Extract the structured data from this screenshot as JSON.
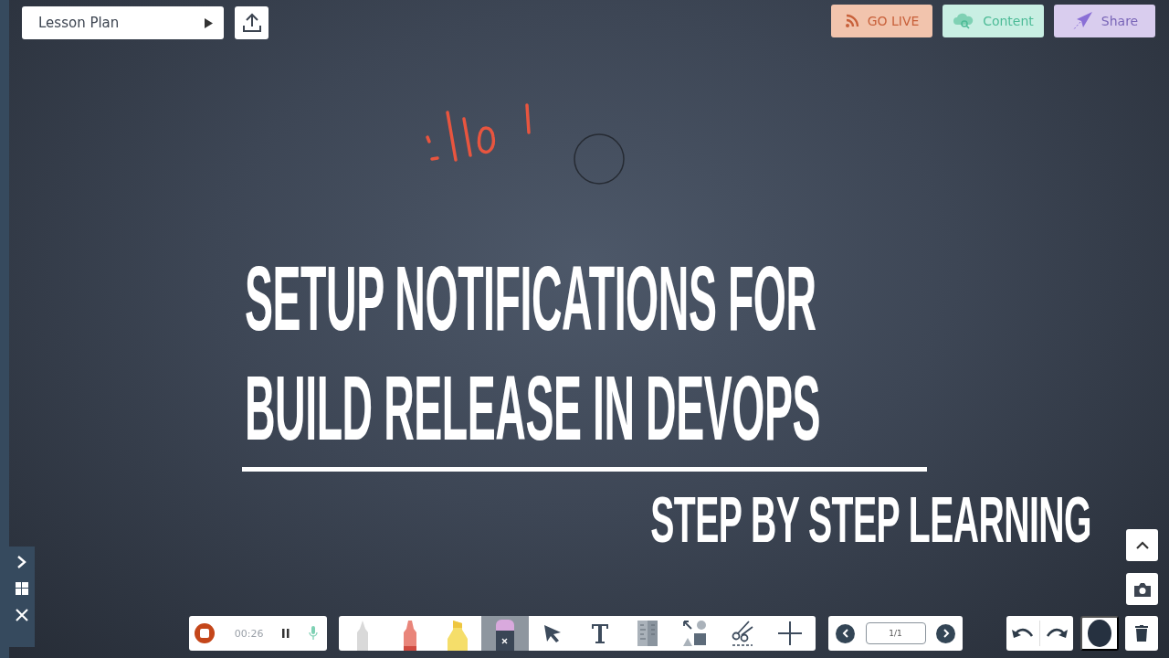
{
  "top_bar": {
    "lesson_plan": {
      "label": "Lesson Plan"
    },
    "buttons": [
      {
        "label": "GO LIVE",
        "kind": "live"
      },
      {
        "label": "Content",
        "kind": "content"
      },
      {
        "label": "Share",
        "kind": "share"
      }
    ]
  },
  "canvas": {
    "title_lines": [
      "SETUP NOTIFICATIONS FOR",
      "BUILD RELEASE IN DEVOPS"
    ],
    "subtitle": "STEP BY STEP LEARNING"
  },
  "recorder": {
    "time": "00:26"
  },
  "tools": [
    {
      "kind": "pencil",
      "color": "#d9d9d9",
      "selected": false
    },
    {
      "kind": "marker",
      "color": "#e9857a",
      "selected": false
    },
    {
      "kind": "highlighter",
      "color": "#f5de6a",
      "selected": false
    },
    {
      "kind": "eraser",
      "color": "#d9a9dd",
      "selected": true
    },
    {
      "kind": "pointer",
      "selected": false
    },
    {
      "kind": "text",
      "selected": false
    },
    {
      "kind": "ruler",
      "selected": false
    },
    {
      "kind": "shapes",
      "selected": false
    },
    {
      "kind": "scissors",
      "selected": false
    },
    {
      "kind": "plus",
      "selected": false
    }
  ],
  "pager": {
    "page": "1/1"
  }
}
